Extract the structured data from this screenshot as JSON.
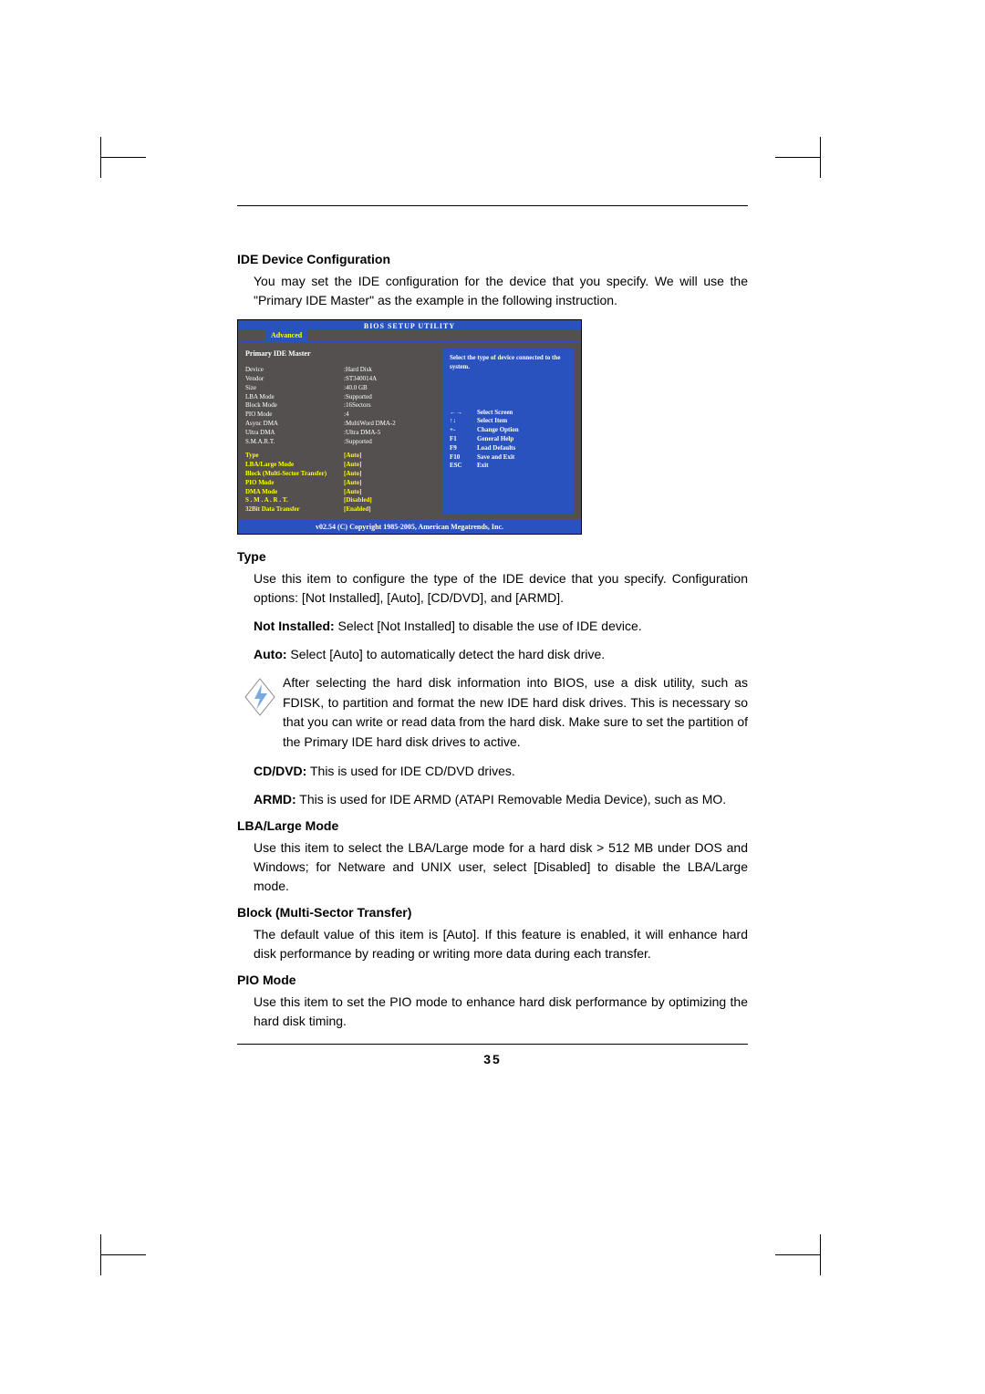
{
  "page_number": "35",
  "main_heading": "IDE Device Configuration",
  "intro": "You may set the IDE configuration for the device that you specify. We will use the \"Primary IDE Master\" as the example in the following instruction.",
  "bios": {
    "title": "BIOS SETUP UTILITY",
    "tab": "Advanced",
    "section": "Primary IDE Master",
    "info_rows": [
      {
        "k": "Device",
        "v": ":Hard Disk"
      },
      {
        "k": "Vendor",
        "v": ":ST340014A"
      },
      {
        "k": "Size",
        "v": ":40.0 GB"
      },
      {
        "k": "LBA Mode",
        "v": ":Supported"
      },
      {
        "k": "Block Mode",
        "v": ":16Sectors"
      },
      {
        "k": "PIO Mode",
        "v": ":4"
      },
      {
        "k": "Async DMA",
        "v": ":MultiWord DMA-2"
      },
      {
        "k": "Ultra DMA",
        "v": ":Ultra DMA-5"
      },
      {
        "k": "S.M.A.R.T.",
        "v": ":Supported"
      }
    ],
    "opt_rows": [
      {
        "k": "Type",
        "v": "[Auto]"
      },
      {
        "k": "LBA/Large Mode",
        "v": "[Auto]"
      },
      {
        "k": "Block (Multi-Sector Transfer)",
        "v": "[Auto]"
      },
      {
        "k": "PIO Mode",
        "v": "[Auto]"
      },
      {
        "k": "DMA Mode",
        "v": "[Auto]"
      },
      {
        "k": "S . M . A . R . T.",
        "v": "[Disabled]"
      },
      {
        "k": "32Bit Data Transfer",
        "v": "[Enabled]"
      }
    ],
    "help_top": "Select the type of device connected to the system.",
    "nav": [
      {
        "k": "←→",
        "v": "Select Screen"
      },
      {
        "k": "↑↓",
        "v": "Select Item"
      },
      {
        "k": "+-",
        "v": "Change Option"
      },
      {
        "k": "F1",
        "v": "General Help"
      },
      {
        "k": "F9",
        "v": "Load Defaults"
      },
      {
        "k": "F10",
        "v": "Save and Exit"
      },
      {
        "k": "ESC",
        "v": "Exit"
      }
    ],
    "footer": "v02.54 (C) Copyright 1985-2005, American Megatrends, Inc."
  },
  "type": {
    "heading": "Type",
    "p1": "Use this item to configure the type of the IDE device that you specify. Configuration options: [Not Installed], [Auto], [CD/DVD], and [ARMD].",
    "p2a": "Not Installed:",
    "p2b": " Select [Not Installed] to disable the use of IDE device.",
    "p3a": "Auto:",
    "p3b": " Select [Auto] to automatically detect the hard disk drive.",
    "tip": "After selecting the hard disk information into BIOS, use a disk utility, such as FDISK, to partition and format the new IDE hard disk drives. This is necessary so that you can write or read data from the hard disk. Make sure to set the partition of the Primary IDE hard disk drives to active.",
    "p4a": "CD/DVD:",
    "p4b": " This is used for IDE CD/DVD drives.",
    "p5a": "ARMD:",
    "p5b": " This is used for IDE ARMD (ATAPI Removable Media Device), such as MO."
  },
  "lba": {
    "heading": "LBA/Large Mode",
    "body": "Use this item to select the LBA/Large mode for a hard disk > 512 MB under DOS and Windows; for Netware and UNIX user, select [Disabled] to disable the LBA/Large mode."
  },
  "block": {
    "heading": "Block (Multi-Sector Transfer)",
    "body": "The default value of this item is [Auto]. If this feature is enabled, it will enhance hard disk performance by reading or writing more data during each transfer."
  },
  "pio": {
    "heading": "PIO Mode",
    "body": "Use this item to set the PIO mode to enhance hard disk performance by optimizing the hard disk timing."
  }
}
